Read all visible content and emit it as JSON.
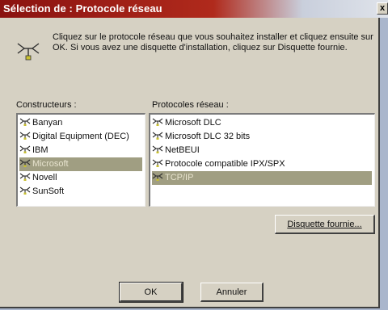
{
  "window": {
    "title": "Sélection de : Protocole réseau",
    "close_label": "x"
  },
  "intro": {
    "text": "Cliquez sur le protocole réseau que vous souhaitez installer et cliquez ensuite sur OK. Si vous avez une disquette d'installation, cliquez sur Disquette fournie."
  },
  "manufacturers": {
    "label": "Constructeurs :",
    "items": [
      {
        "label": "Banyan"
      },
      {
        "label": "Digital Equipment (DEC)"
      },
      {
        "label": "IBM"
      },
      {
        "label": "Microsoft"
      },
      {
        "label": "Novell"
      },
      {
        "label": "SunSoft"
      }
    ],
    "selected_index": 3
  },
  "protocols": {
    "label": "Protocoles réseau :",
    "items": [
      {
        "label": "Microsoft DLC"
      },
      {
        "label": "Microsoft DLC 32 bits"
      },
      {
        "label": "NetBEUI"
      },
      {
        "label": "Protocole compatible IPX/SPX"
      },
      {
        "label": "TCP/IP"
      }
    ],
    "selected_index": 4
  },
  "buttons": {
    "have_disk": "Disquette fournie...",
    "ok": "OK",
    "cancel": "Annuler"
  },
  "colors": {
    "titlebar_start": "#8a1210",
    "selection": "#a09e82",
    "dialog_face": "#d6d1c3"
  }
}
